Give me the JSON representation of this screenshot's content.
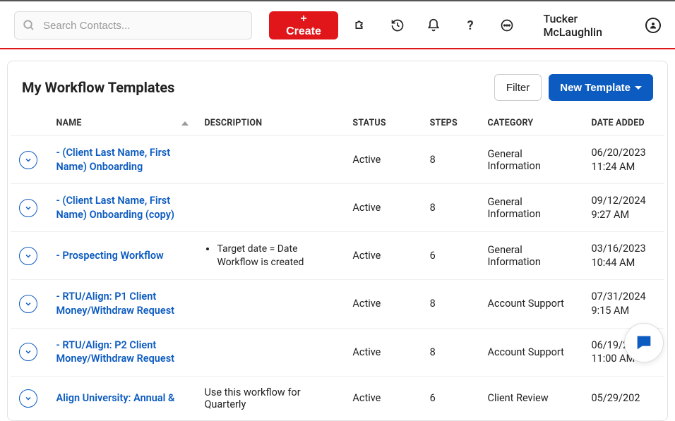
{
  "header": {
    "search_placeholder": "Search Contacts...",
    "create_label": "+ Create",
    "user_name": "Tucker McLaughlin"
  },
  "page": {
    "title": "My Workflow Templates",
    "filter_label": "Filter",
    "new_template_label": "New Template"
  },
  "columns": {
    "name": "NAME",
    "description": "DESCRIPTION",
    "status": "STATUS",
    "steps": "STEPS",
    "category": "CATEGORY",
    "date_added": "DATE ADDED"
  },
  "rows": [
    {
      "name": "- (Client Last Name, First Name) Onboarding",
      "description": "",
      "status": "Active",
      "steps": "8",
      "category": "General Information",
      "date": "06/20/2023",
      "time": "11:24 AM"
    },
    {
      "name": "- (Client Last Name, First Name) Onboarding (copy)",
      "description": "",
      "status": "Active",
      "steps": "8",
      "category": "General Information",
      "date": "09/12/2024",
      "time": "9:27 AM"
    },
    {
      "name": "- Prospecting Workflow",
      "description_items": [
        "Target date = Date Workflow is created"
      ],
      "status": "Active",
      "steps": "6",
      "category": "General Information",
      "date": "03/16/2023",
      "time": "10:44 AM"
    },
    {
      "name": "- RTU/Align: P1 Client Money/Withdraw Request",
      "description": "",
      "status": "Active",
      "steps": "8",
      "category": "Account Support",
      "date": "07/31/2024",
      "time": "9:15 AM"
    },
    {
      "name": "- RTU/Align: P2 Client Money/Withdraw Request",
      "description": "",
      "status": "Active",
      "steps": "8",
      "category": "Account Support",
      "date": "06/19/2024",
      "time": "11:00 AM"
    },
    {
      "name": "Align University: Annual &",
      "description": "Use this workflow for Quarterly",
      "status": "Active",
      "steps": "6",
      "category": "Client Review",
      "date": "05/29/202",
      "time": ""
    }
  ]
}
